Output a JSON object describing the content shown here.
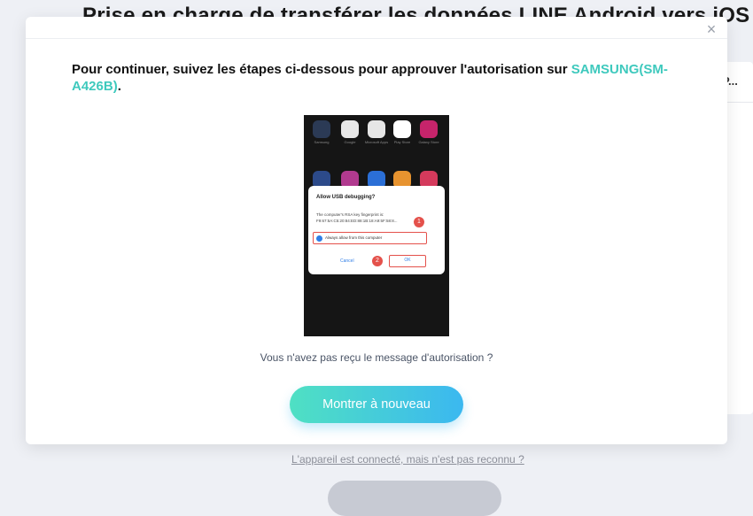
{
  "background": {
    "title": "Prise en charge de transférer les données LINE Android vers iOS",
    "tab_label": "P...",
    "not_recognized_link": "L'appareil est connecté, mais n'est pas reconnu ?"
  },
  "modal": {
    "close_glyph": "×",
    "instruction_text": "Pour continuer, suivez les étapes ci-dessous pour approuver l'autorisation sur ",
    "device_name": "SAMSUNG(SM-A426B)",
    "instruction_end": ".",
    "help_text": "Vous n'avez pas reçu le message d'autorisation ?",
    "show_again_label": "Montrer à nouveau",
    "phone": {
      "dialog_title": "Allow USB debugging?",
      "dialog_text": "The computer's RSA key fingerprint is: F9:67:5A:C5:20:84:ED:88:1B:18:A9:5F:58:8...",
      "checkbox_label": "Always allow from this computer",
      "cancel_label": "Cancel",
      "ok_label": "OK",
      "step1": "1",
      "step2": "2",
      "apps": [
        "Samsung",
        "Google",
        "Microsoft Apps",
        "Play Store",
        "Galaxy Store"
      ]
    }
  },
  "colors": {
    "accent": "#3ec9bd",
    "button_gradient_start": "#4fe0c3",
    "button_gradient_end": "#3bb8f0",
    "highlight": "#e4514b"
  }
}
